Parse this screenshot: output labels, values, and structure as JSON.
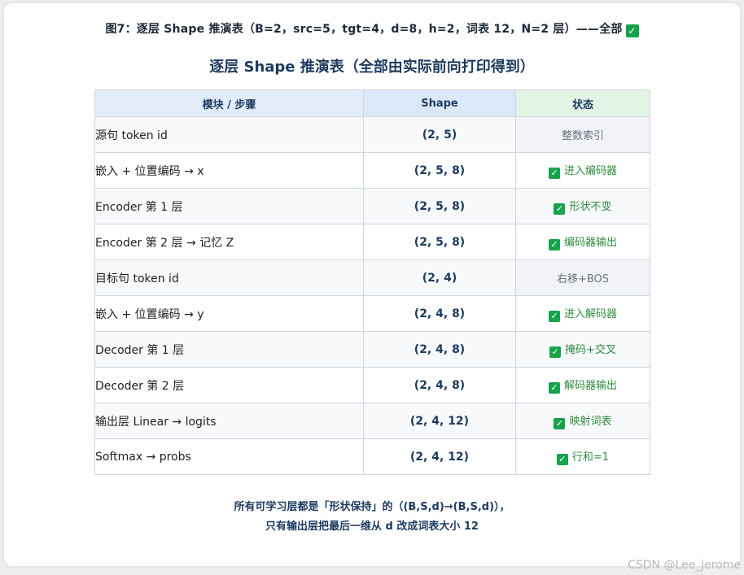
{
  "figure_caption": "图7：逐层 Shape 推演表（B=2，src=5，tgt=4，d=8，h=2，词表 12，N=2 层）——全部",
  "table_title": "逐层 Shape 推演表（全部由实际前向打印得到）",
  "table": {
    "headers": [
      "模块 / 步骤",
      "Shape",
      "状态"
    ],
    "rows": [
      {
        "step": "源句 token id",
        "shape": "(2, 5)",
        "status": "整数索引",
        "check": false
      },
      {
        "step": "嵌入 + 位置编码 → x",
        "shape": "(2, 5, 8)",
        "status": "进入编码器",
        "check": true
      },
      {
        "step": "Encoder 第 1 层",
        "shape": "(2, 5, 8)",
        "status": "形状不变",
        "check": true
      },
      {
        "step": "Encoder 第 2 层 → 记忆 Z",
        "shape": "(2, 5, 8)",
        "status": "编码器输出",
        "check": true
      },
      {
        "step": "目标句 token id",
        "shape": "(2, 4)",
        "status": "右移+BOS",
        "check": false
      },
      {
        "step": "嵌入 + 位置编码 → y",
        "shape": "(2, 4, 8)",
        "status": "进入解码器",
        "check": true
      },
      {
        "step": "Decoder 第 1 层",
        "shape": "(2, 4, 8)",
        "status": "掩码+交叉",
        "check": true
      },
      {
        "step": "Decoder 第 2 层",
        "shape": "(2, 4, 8)",
        "status": "解码器输出",
        "check": true
      },
      {
        "step": "输出层 Linear → logits",
        "shape": "(2, 4, 12)",
        "status": "映射词表",
        "check": true
      },
      {
        "step": "Softmax → probs",
        "shape": "(2, 4, 12)",
        "status": "行和=1",
        "check": true
      }
    ]
  },
  "footnote": {
    "line1": "所有可学习层都是「形状保持」的（(B,S,d)→(B,S,d)），",
    "line2": "只有输出层把最后一维从 d 改成词表大小 12"
  },
  "watermark": "CSDN @Lee_jerome",
  "icons": {
    "check": "check-mark-icon",
    "check_glyph": "✓"
  },
  "colors": {
    "green": "#16a34a",
    "title": "#1e3a5f",
    "header_shape_bg": "#dbe8f8",
    "header_status_bg": "#e3f3e6"
  }
}
